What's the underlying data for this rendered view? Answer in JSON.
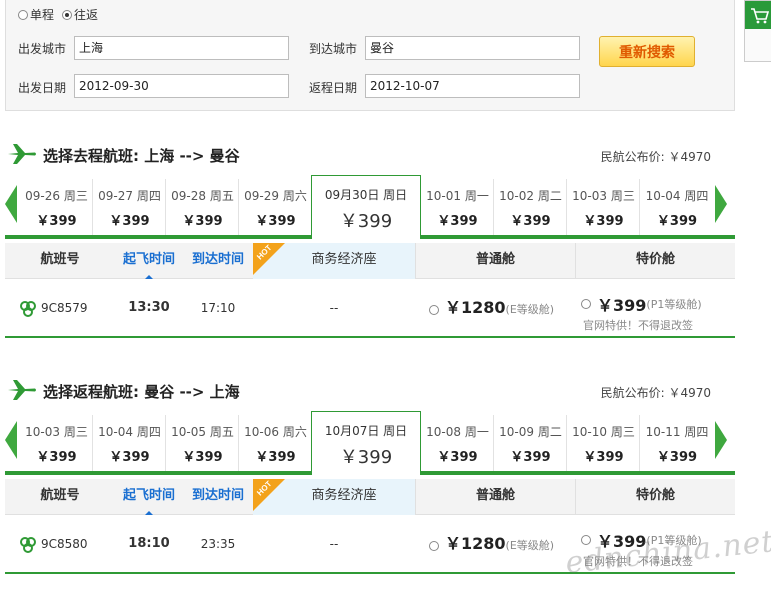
{
  "search": {
    "trip_types": [
      {
        "label": "单程",
        "checked": false
      },
      {
        "label": "往返",
        "checked": true
      }
    ],
    "depart_city_label": "出发城市",
    "depart_city_value": "上海",
    "arrive_city_label": "到达城市",
    "arrive_city_value": "曼谷",
    "depart_date_label": "出发日期",
    "depart_date_value": "2012-09-30",
    "return_date_label": "返程日期",
    "return_date_value": "2012-10-07",
    "search_button": "重新搜索"
  },
  "outbound": {
    "title": "选择去程航班: 上海 --> 曼谷",
    "price_ref": "民航公布价: ￥4970",
    "dates": [
      {
        "date": "09-26 周三",
        "price": "￥399"
      },
      {
        "date": "09-27 周四",
        "price": "￥399"
      },
      {
        "date": "09-28 周五",
        "price": "￥399"
      },
      {
        "date": "09-29 周六",
        "price": "￥399"
      },
      {
        "date": "09月30日 周日",
        "price": "￥399",
        "selected": true
      },
      {
        "date": "10-01 周一",
        "price": "￥399"
      },
      {
        "date": "10-02 周二",
        "price": "￥399"
      },
      {
        "date": "10-03 周三",
        "price": "￥399"
      },
      {
        "date": "10-04 周四",
        "price": "￥399"
      }
    ],
    "flight": {
      "number": "9C8579",
      "dep_time": "13:30",
      "arr_time": "17:10",
      "business": "--",
      "economy_price": "￥1280",
      "economy_class": "(E等级舱)",
      "special_price": "￥399",
      "special_class": "(P1等级舱)",
      "special_note": "官网特供！不得退改签"
    }
  },
  "inbound": {
    "title": "选择返程航班: 曼谷 --> 上海",
    "price_ref": "民航公布价: ￥4970",
    "dates": [
      {
        "date": "10-03 周三",
        "price": "￥399"
      },
      {
        "date": "10-04 周四",
        "price": "￥399"
      },
      {
        "date": "10-05 周五",
        "price": "￥399"
      },
      {
        "date": "10-06 周六",
        "price": "￥399"
      },
      {
        "date": "10月07日 周日",
        "price": "￥399",
        "selected": true
      },
      {
        "date": "10-08 周一",
        "price": "￥399"
      },
      {
        "date": "10-09 周二",
        "price": "￥399"
      },
      {
        "date": "10-10 周三",
        "price": "￥399"
      },
      {
        "date": "10-11 周四",
        "price": "￥399"
      }
    ],
    "flight": {
      "number": "9C8580",
      "dep_time": "18:10",
      "arr_time": "23:35",
      "business": "--",
      "economy_price": "￥1280",
      "economy_class": "(E等级舱)",
      "special_price": "￥399",
      "special_class": "(P1等级舱)",
      "special_note": "官网特供！不得退改签"
    }
  },
  "columns": {
    "flight_no": "航班号",
    "dep_time": "起飞时间",
    "arr_time": "到达时间",
    "hot": "HOT",
    "business": "商务经济座",
    "economy": "普通舱",
    "special": "特价舱"
  },
  "watermark": "ednchina.net",
  "colors": {
    "green": "#2f9a35",
    "blue": "#1a6fd1",
    "orange": "#e05a00"
  }
}
